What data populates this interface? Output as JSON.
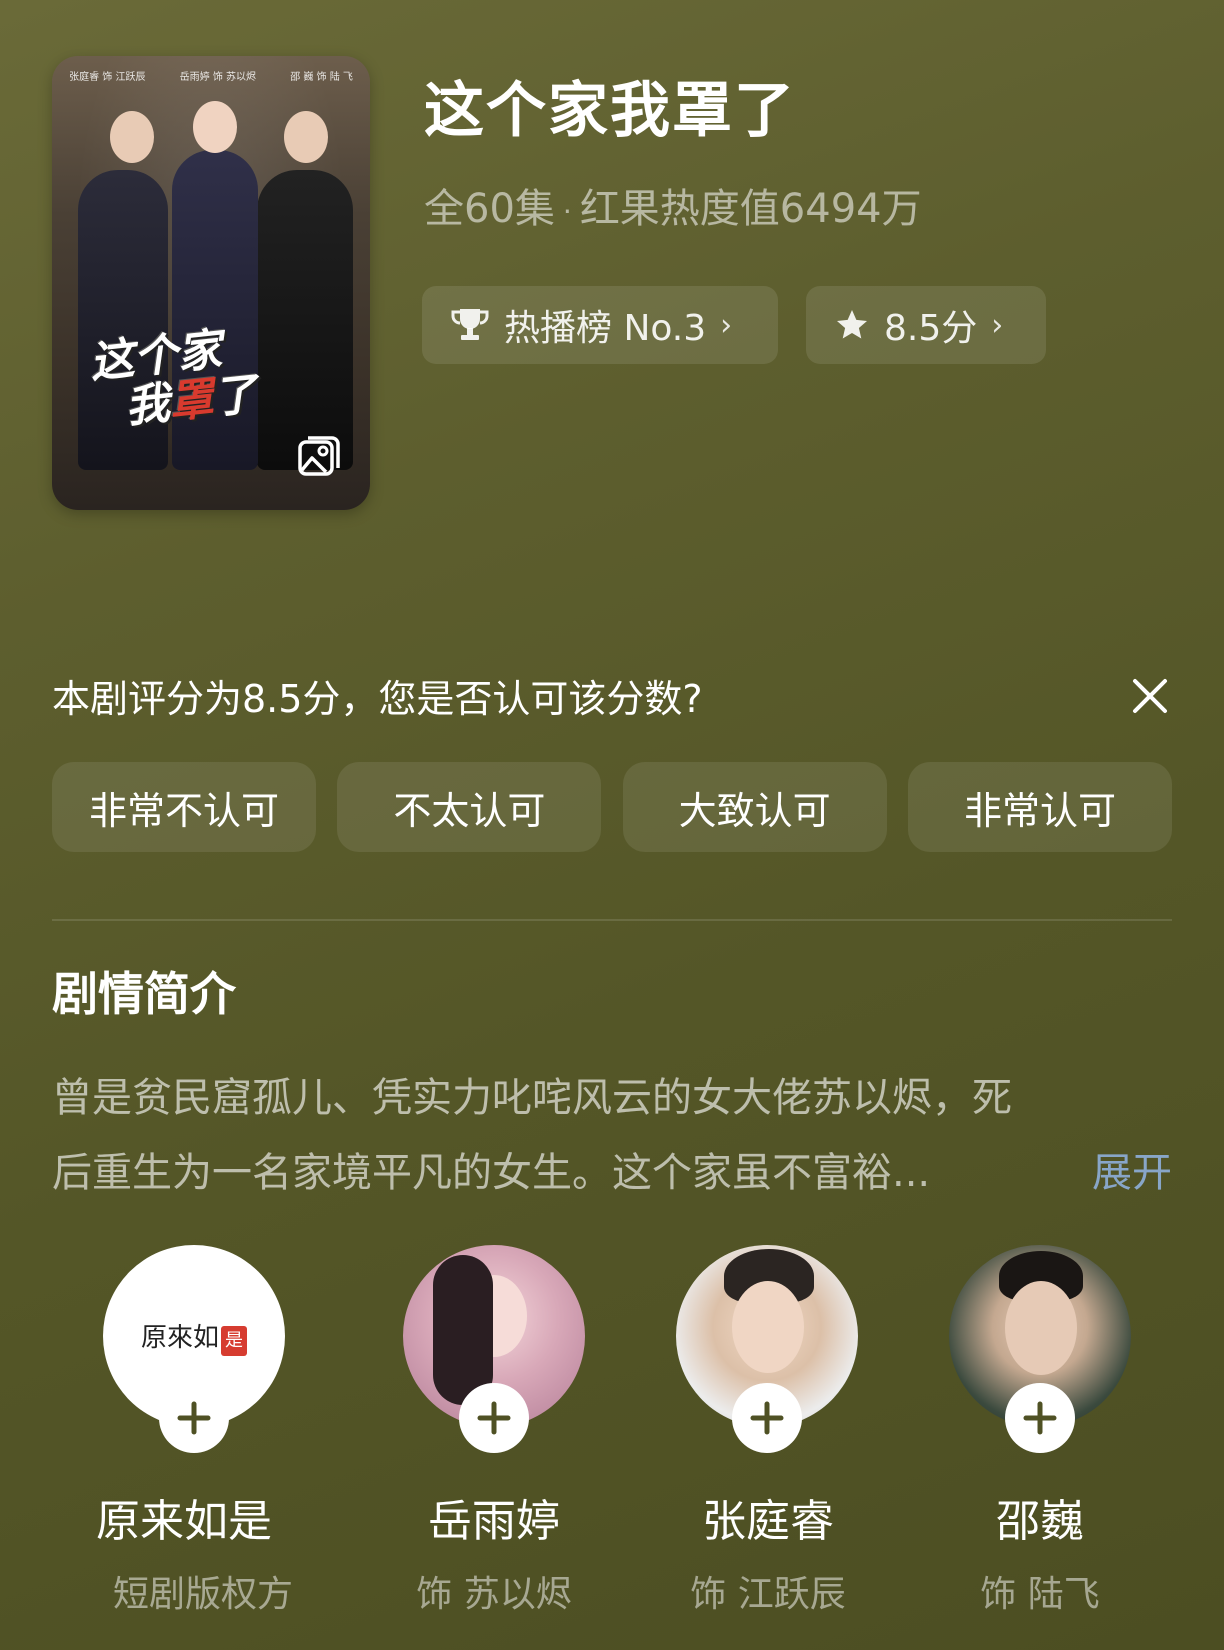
{
  "show": {
    "title": "这个家我罩了",
    "episodes": "全60集",
    "separator": "·",
    "heat": "红果热度值6494万",
    "rank_label": "热播榜 No.3",
    "score_label": "8.5分",
    "poster": {
      "cast_strip": [
        "张庭睿 饰 江跃辰",
        "岳雨婷 饰 苏以烬",
        "邵 巍 饰 陆 飞"
      ],
      "title_line1": "这个家",
      "title_line2_a": "我",
      "title_line2_b": "罩",
      "title_line2_c": "了"
    }
  },
  "rating": {
    "question": "本剧评分为8.5分，您是否认可该分数?",
    "options": [
      "非常不认可",
      "不太认可",
      "大致认可",
      "非常认可"
    ]
  },
  "synopsis": {
    "heading": "剧情简介",
    "line1": "曾是贫民窟孤儿、凭实力叱咤风云的女大佬苏以烬，死",
    "line2": "后重生为一名家境平凡的女生。这个家虽不富裕...",
    "expand": "展开"
  },
  "cast": [
    {
      "name": "原来如是",
      "role": "短剧版权方",
      "logo_text": "原來如",
      "logo_seal": "是"
    },
    {
      "name": "岳雨婷",
      "role": "饰 苏以烬"
    },
    {
      "name": "张庭睿",
      "role": "饰 江跃辰"
    },
    {
      "name": "邵巍",
      "role": "饰 陆飞"
    }
  ],
  "icons": {
    "rank": "trophy-icon",
    "score": "star-icon",
    "close": "close-icon",
    "follow": "plus-icon",
    "gallery": "gallery-icon"
  }
}
